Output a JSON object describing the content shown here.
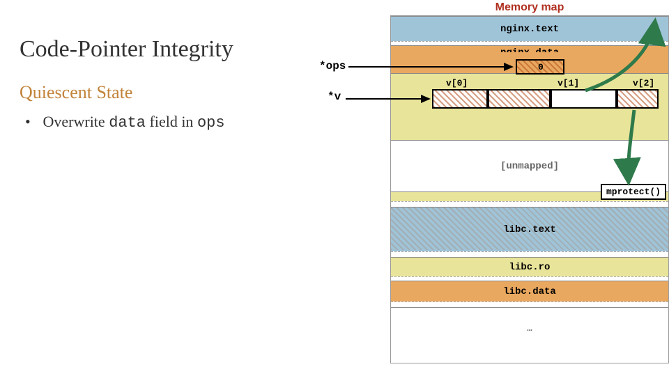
{
  "title": "Code-Pointer Integrity",
  "subtitle": "Quiescent State",
  "bullet_dot": "•",
  "bullet_prefix": "Overwrite ",
  "bullet_code1": "data",
  "bullet_mid": " field in ",
  "bullet_code2": "ops",
  "map_title": "Memory map",
  "ptr_ops": "*ops",
  "ptr_v": "*v",
  "ops_zero": "0",
  "v_labels": {
    "v0": "v[0]",
    "v1": "v[1]",
    "v2": "v[2]"
  },
  "mprotect": "mprotect()",
  "regions": {
    "nginx_text": "nginx.text",
    "nginx_data": "nginx.data",
    "unmapped": "[unmapped]",
    "libc_text": "libc.text",
    "libc_ro": "libc.ro",
    "libc_data": "libc.data",
    "ellipsis": "…"
  }
}
